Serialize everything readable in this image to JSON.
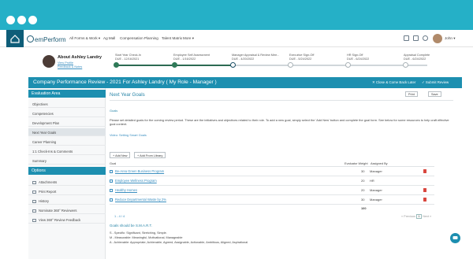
{
  "app": {
    "logo": "emPerform"
  },
  "nav": {
    "items": [
      "All Forms & Work ▾",
      "Ag Mall",
      "Compensation Planning",
      "Talent Matrix",
      "More ▾"
    ],
    "user": "John ▾"
  },
  "employee": {
    "name": "About Ashley Landry",
    "links": [
      "View Profile",
      "Feedback & Notes"
    ]
  },
  "progress": {
    "steps": [
      {
        "title": "Start Year Check-In",
        "due": "DUE - 12/16/2021",
        "state": "done"
      },
      {
        "title": "Employee Self Assessment",
        "due": "DUE - 1/16/2022",
        "state": "done"
      },
      {
        "title": "Manager Appraisal & Review Mee...",
        "due": "DUE - 4/20/2022",
        "state": "current"
      },
      {
        "title": "Executive Sign-Off",
        "due": "DUE - 5/24/2022",
        "state": "todo"
      },
      {
        "title": "HR Sign-Off",
        "due": "DUE - 6/24/2022",
        "state": "todo"
      },
      {
        "title": "Appraisal Complete",
        "due": "DUE - 6/24/2022",
        "state": "todo"
      }
    ]
  },
  "header": {
    "title": "Company Performance Review - 2021 For Ashley Landry ( My Role - Manager )",
    "close_label": "✕  Close & Come Back Later",
    "submit_label": "✓  Submit Review"
  },
  "sidebar": {
    "eval_heading": "Evaluation Area",
    "eval_items": [
      "Objectives",
      "Competencies",
      "Development Plan",
      "Next Year Goals",
      "Career Planning",
      "1:1 Check-Ins & Comments",
      "Summary"
    ],
    "active_item": "Next Year Goals",
    "options_heading": "Options",
    "option_items": [
      "Attachments",
      "Print Report",
      "History",
      "Nominate 360° Reviewers",
      "View 360° Review Feedback"
    ]
  },
  "main": {
    "section_title": "Next Year Goals",
    "print_label": "Print",
    "save_label": "Save",
    "sub_label": "Goals",
    "instructions": "Please set detailed goals for the coming review period. These are the initiatives and objectives related to their role. To add a new goal, simply select the 'Add New' button and complete the goal form. See below for some resources to help craft effective goal content.",
    "video_link": "Video: Setting Smart Goals",
    "add_new_label": "+ Add New",
    "add_library_label": "+ Add From Library",
    "col_goal": "Goal",
    "col_weight": "Evaluator Weight",
    "col_assigned": "Assigned By",
    "goals": [
      {
        "name": "Be-Area Green Business Program",
        "weight": "30",
        "assigned": "Manager"
      },
      {
        "name": "Employee Wellness Program",
        "weight": "20",
        "assigned": "HR"
      },
      {
        "name": "Healthy Homes",
        "weight": "20",
        "assigned": "Manager"
      },
      {
        "name": "Reduce Departmental Waste by 2%",
        "weight": "30",
        "assigned": "Manager"
      }
    ],
    "total_weight": "100",
    "record_count": "1 - 4 / 4",
    "pager": {
      "prev": "« Previous",
      "page": "1",
      "next": "Next »"
    },
    "smart_title": "Goals should be S.M.A.R.T.",
    "smart_lines": [
      "S - Specific: Significant, Stretching, Simple.",
      "M - Measurable: Meaningful, Motivational, Manageable",
      "A - Achievable: Appropriate, Achievable, Agreed, Assignable, Actionable, Ambitious, Aligned, Aspirational"
    ]
  },
  "colors": {
    "accent": "#1d8fb0",
    "window": "#25b0c7",
    "done": "#2f7a58",
    "danger": "#d9463e"
  }
}
